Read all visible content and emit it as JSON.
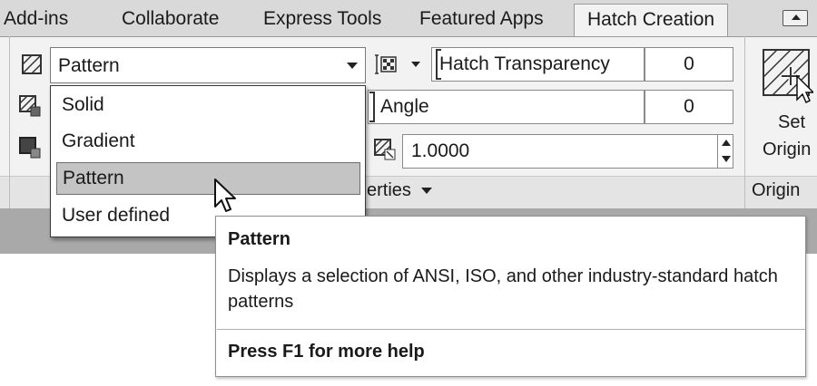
{
  "tabs": {
    "addins": "Add-ins",
    "collaborate": "Collaborate",
    "express_tools": "Express Tools",
    "featured_apps": "Featured Apps",
    "hatch_creation": "Hatch Creation"
  },
  "hatch_type": {
    "selected": "Pattern",
    "options": [
      "Solid",
      "Gradient",
      "Pattern",
      "User defined"
    ]
  },
  "properties": {
    "transparency_label": "Hatch Transparency",
    "transparency_value": "0",
    "angle_label": "Angle",
    "angle_value": "0",
    "scale_value": "1.0000",
    "panel_label_partial": "erties"
  },
  "origin": {
    "button_line1": "Set",
    "button_line2": "Origin",
    "panel_label": "Origin"
  },
  "tooltip": {
    "title": "Pattern",
    "description": "Displays a selection of ANSI, ISO, and other industry-standard hatch patterns",
    "help": "Press F1 for more help"
  },
  "colors": {
    "ribbon_bg": "#f2f2f2",
    "tabbar_bg": "#d9d9d9",
    "selection": "#c4c4c4"
  },
  "icons": [
    "hatch-type-icon",
    "hatch-color-icon",
    "background-color-icon",
    "transparency-icon",
    "angle-bracket-icon",
    "scale-icon",
    "set-origin-icon",
    "cursor-arrow-icon"
  ]
}
